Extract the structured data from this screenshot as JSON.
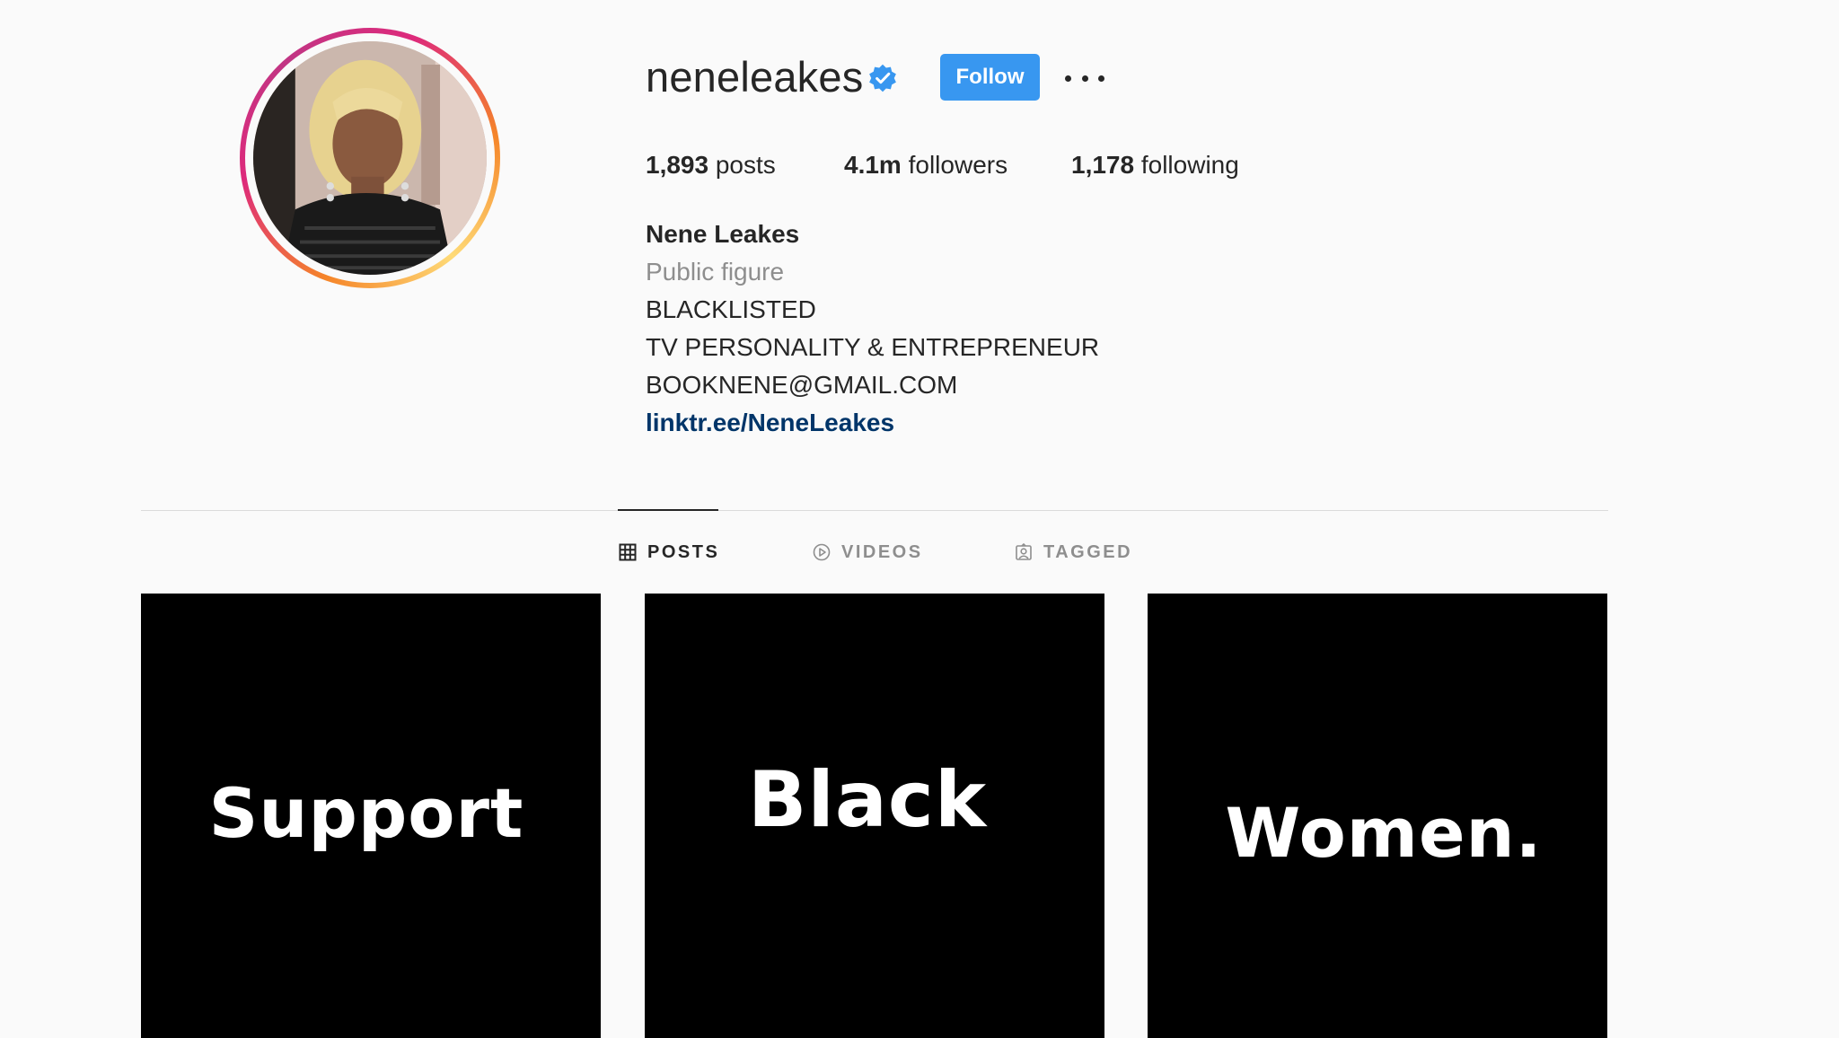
{
  "profile": {
    "username": "neneleakes",
    "verified_icon": "verified-badge-icon",
    "follow_label": "Follow",
    "more_icon": "more-options-icon",
    "avatar_icon": "profile-photo",
    "accent_color": "#3897f0"
  },
  "stats": {
    "posts_count": "1,893",
    "posts_label": " posts",
    "followers_count": "4.1m",
    "followers_label": " followers",
    "following_count": "1,178",
    "following_label": " following"
  },
  "bio": {
    "full_name": "Nene Leakes",
    "category": "Public figure",
    "line1": "BLACKLISTED",
    "line2": "TV PERSONALITY & ENTREPRENEUR",
    "line3": "BOOKNENE@GMAIL.COM",
    "link": "linktr.ee/NeneLeakes",
    "link_color": "#003569"
  },
  "tabs": [
    {
      "label": "POSTS",
      "icon": "grid-icon",
      "active": true
    },
    {
      "label": "VIDEOS",
      "icon": "play-icon",
      "active": false
    },
    {
      "label": "TAGGED",
      "icon": "tagged-user-icon",
      "active": false
    }
  ],
  "posts": [
    {
      "text": "Support"
    },
    {
      "text": "Black"
    },
    {
      "text": "Women."
    }
  ]
}
